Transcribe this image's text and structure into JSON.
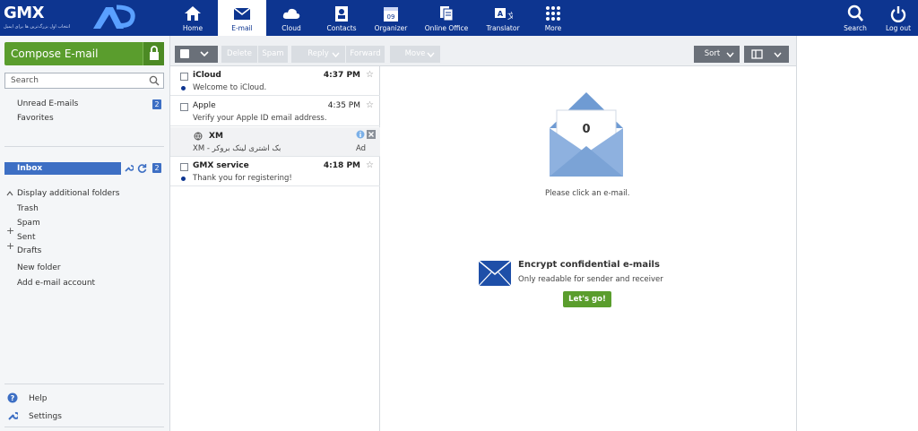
{
  "brand": {
    "name": "GMX",
    "tagline": "انتخاب اول بزرگ‌ترین ها برای ایمیل"
  },
  "nav": [
    {
      "label": "Home",
      "icon": "home-icon"
    },
    {
      "label": "E-mail",
      "icon": "envelope-icon"
    },
    {
      "label": "Cloud",
      "icon": "cloud-icon"
    },
    {
      "label": "Contacts",
      "icon": "contacts-icon"
    },
    {
      "label": "Organizer",
      "icon": "calendar-icon",
      "calendar_day": "09"
    },
    {
      "label": "Online Office",
      "icon": "document-icon"
    },
    {
      "label": "Translator",
      "icon": "translate-icon"
    },
    {
      "label": "More",
      "icon": "grid-icon"
    }
  ],
  "nav_right": [
    {
      "label": "Search",
      "icon": "search-icon"
    },
    {
      "label": "Log out",
      "icon": "power-icon"
    }
  ],
  "sidebar": {
    "compose_label": "Compose E-mail",
    "search_placeholder": "Search",
    "unread_label": "Unread E-mails",
    "unread_count": "2",
    "favorites_label": "Favorites",
    "inbox_label": "Inbox",
    "inbox_count": "2",
    "display_folders_label": "Display additional folders",
    "folders": [
      "Trash",
      "Spam",
      "Sent",
      "Drafts"
    ],
    "new_folder_label": "New folder",
    "add_account_label": "Add e-mail account",
    "help_label": "Help",
    "settings_label": "Settings"
  },
  "toolbar": {
    "delete_label": "Delete",
    "spam_label": "Spam",
    "reply_label": "Reply",
    "forward_label": "Forward",
    "move_label": "Move",
    "sort_label": "Sort"
  },
  "emails": [
    {
      "from": "iCloud",
      "time": "4:37 PM",
      "subject": "Welcome to iCloud.",
      "unread": true
    },
    {
      "from": "Apple",
      "time": "4:35 PM",
      "subject": "Verify your Apple ID email address.",
      "unread": false
    },
    {
      "from": "XM",
      "subject": "XM - بک اشتری لینک بروکر",
      "ad_label": "Ad",
      "is_ad": true
    },
    {
      "from": "GMX service",
      "time": "4:18 PM",
      "subject": "Thank you for registering!",
      "unread": true
    }
  ],
  "reading": {
    "envelope_count": "0",
    "empty_text": "Please click an e-mail.",
    "encrypt_title": "Encrypt confidential e-mails",
    "encrypt_subtitle": "Only readable for sender and receiver",
    "cta_label": "Let's go!"
  },
  "colors": {
    "nav_bg": "#0d3590",
    "accent_green": "#5a9d2d",
    "inbox_blue": "#3d6fc4",
    "envelope_blue": "#7ba3d6"
  }
}
